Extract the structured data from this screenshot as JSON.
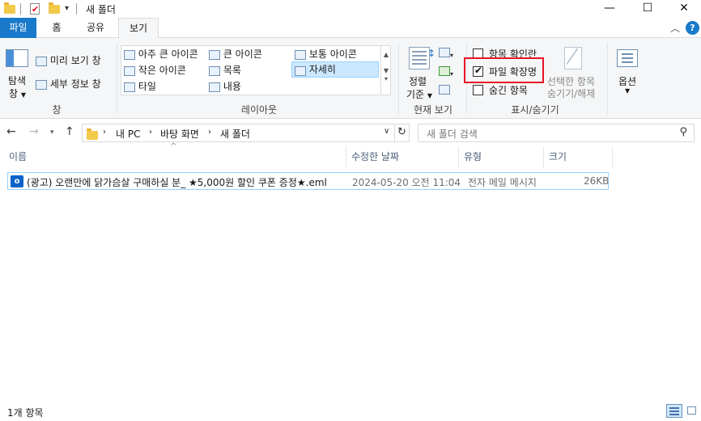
{
  "window": {
    "title": "새 폴더"
  },
  "tabs": {
    "file": "파일",
    "home": "홈",
    "share": "공유",
    "view": "보기"
  },
  "ribbon": {
    "pane": {
      "nav_label_1": "탐색",
      "nav_label_2": "창",
      "preview": "미리 보기 창",
      "details": "세부 정보 창",
      "group": "창"
    },
    "layout": {
      "items": [
        "아주 큰 아이콘",
        "큰 아이콘",
        "보통 아이콘",
        "작은 아이콘",
        "목록",
        "자세히",
        "타일",
        "내용"
      ],
      "selected": "자세히",
      "group": "레이아웃"
    },
    "current_view": {
      "sort_1": "정렬",
      "sort_2": "기준",
      "group": "현재 보기"
    },
    "show_hide": {
      "item_checkboxes": "항목 확인란",
      "file_extensions": "파일 확장명",
      "hidden_items": "숨긴 항목",
      "item_checkboxes_checked": false,
      "file_extensions_checked": true,
      "hidden_items_checked": false,
      "hide_selected_1": "선택한 항목",
      "hide_selected_2": "숨기기/해제",
      "group": "표시/숨기기"
    },
    "options": {
      "label": "옵션"
    }
  },
  "address": {
    "crumbs": [
      "내 PC",
      "바탕 화면",
      "새 폴더"
    ]
  },
  "search": {
    "placeholder": "새 폴더 검색"
  },
  "columns": {
    "name": "이름",
    "modified": "수정한 날짜",
    "type": "유형",
    "size": "크기"
  },
  "files": [
    {
      "name": "(광고) 오랜만에 닭가슴살 구매하실 분_ ★5,000원 할인 쿠폰 증정★.eml",
      "modified": "2024-05-20 오전 11:04",
      "type": "전자 메일 메시지",
      "size": "26KB"
    }
  ],
  "status": {
    "count": "1개 항목"
  },
  "colors": {
    "accent": "#1979ca",
    "highlight_box": "#e81123"
  }
}
